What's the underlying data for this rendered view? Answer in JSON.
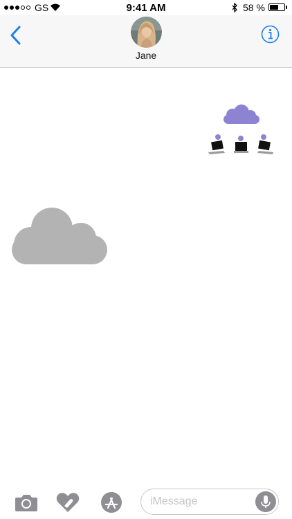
{
  "status_bar": {
    "carrier": "GS",
    "time": "9:41 AM",
    "battery_percent": "58 %",
    "battery_level": 0.58,
    "signal_bars_filled": 3,
    "signal_bars_total": 5
  },
  "header": {
    "contact_name": "Jane",
    "back_icon": "chevron-left-icon",
    "info_icon": "info-icon",
    "accent_color": "#1a7ef2"
  },
  "messages": [
    {
      "type": "sticker",
      "icon": "cloud-network-sticker",
      "side": "right",
      "color": "#8c84d2"
    },
    {
      "type": "sticker",
      "icon": "cloud-sticker",
      "side": "left",
      "color": "#b3b3b3"
    }
  ],
  "composer": {
    "placeholder": "iMessage",
    "value": "",
    "icons": [
      "camera-icon",
      "digital-touch-icon",
      "app-store-icon",
      "microphone-icon"
    ],
    "icon_color": "#8e8e93"
  }
}
